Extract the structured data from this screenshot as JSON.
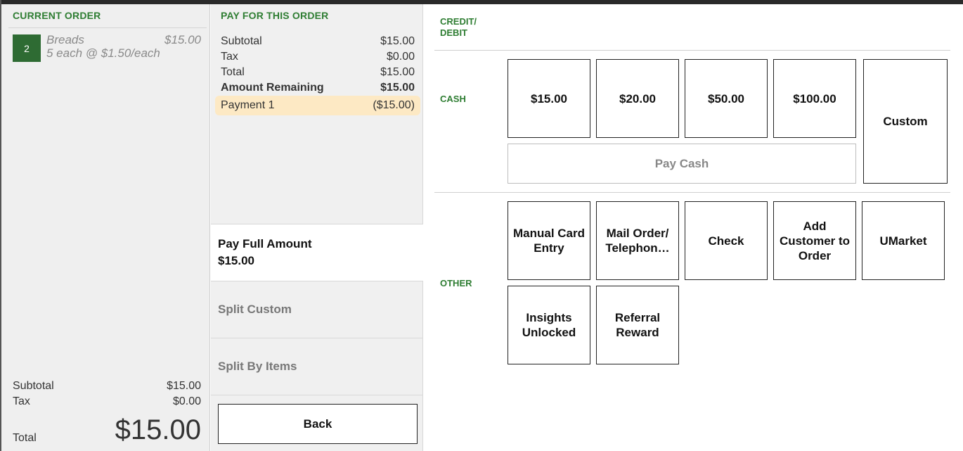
{
  "order": {
    "title": "CURRENT ORDER",
    "item": {
      "qty": "2",
      "name": "Breads",
      "price": "$15.00",
      "detail": "5 each @ $1.50/each"
    },
    "subtotal_label": "Subtotal",
    "subtotal": "$15.00",
    "tax_label": "Tax",
    "tax": "$0.00",
    "total_label": "Total",
    "total": "$15.00"
  },
  "pay": {
    "title": "PAY FOR THIS ORDER",
    "subtotal_label": "Subtotal",
    "subtotal": "$15.00",
    "tax_label": "Tax",
    "tax": "$0.00",
    "total_label": "Total",
    "total": "$15.00",
    "remaining_label": "Amount Remaining",
    "remaining": "$15.00",
    "payment_label": "Payment 1",
    "payment_amount": "($15.00)",
    "full_label": "Pay Full Amount",
    "full_amount": "$15.00",
    "split_custom": "Split Custom",
    "split_items": "Split By Items",
    "back": "Back"
  },
  "methods": {
    "credit_label": "CREDIT/ DEBIT",
    "cash_label": "CASH",
    "other_label": "OTHER",
    "cash_amounts": [
      "$15.00",
      "$20.00",
      "$50.00",
      "$100.00"
    ],
    "custom": "Custom",
    "pay_cash": "Pay Cash",
    "other": [
      "Manual Card Entry",
      "Mail Order/ Telephon…",
      "Check",
      "Add Customer to Order",
      "UMarket",
      "Insights Unlocked",
      "Referral Reward"
    ]
  },
  "colors": {
    "accent": "#2e7d32",
    "qty_badge": "#2e6b33",
    "payment_highlight": "#fde9c4"
  }
}
